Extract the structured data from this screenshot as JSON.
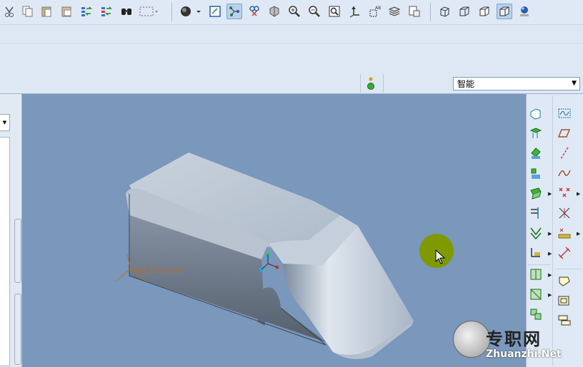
{
  "toolbar": {
    "icons": [
      "cut-icon",
      "copy-icon",
      "paste-icon",
      "paste-special-icon",
      "regenerate-icon",
      "regenerate-manager-icon",
      "find-icon",
      "select-box-icon",
      "shading-icon",
      "redraw-icon",
      "spin-center-icon",
      "view-manager-icon",
      "orient-icon",
      "zoom-in-icon",
      "zoom-out-icon",
      "refit-icon",
      "datum-display-icon",
      "annotation-display-icon",
      "layers-icon",
      "model-tree-icon",
      "view-standard-icon",
      "view-front-icon",
      "view-side-icon",
      "view-iso-icon",
      "appearance-icon"
    ]
  },
  "selection_filter": {
    "value": "智能"
  },
  "viewport": {
    "background": "#7a97bc",
    "csys_label": "PRT_CSYS_DEF"
  },
  "watermark": {
    "text": "专职网",
    "url": "Zhuanzhi.Net"
  },
  "right_toolbar": {
    "icons": [
      "datum-plane-icon",
      "sketch-curve-icon",
      "datum-axis-icon",
      "datum-plane-offset-icon",
      "extrude-icon",
      "datum-axis-line-icon",
      "revolve-icon",
      "datum-curve-icon",
      "sweep-icon",
      "datum-point-icon",
      "blend-icon",
      "csys-icon",
      "hole-icon",
      "analysis-icon",
      "shell-icon",
      "rib-icon",
      "draft-icon",
      "round-icon",
      "chamfer-icon",
      "pattern-icon",
      "mirror-icon",
      "merge-icon",
      "trim-icon",
      "offset-icon"
    ]
  }
}
